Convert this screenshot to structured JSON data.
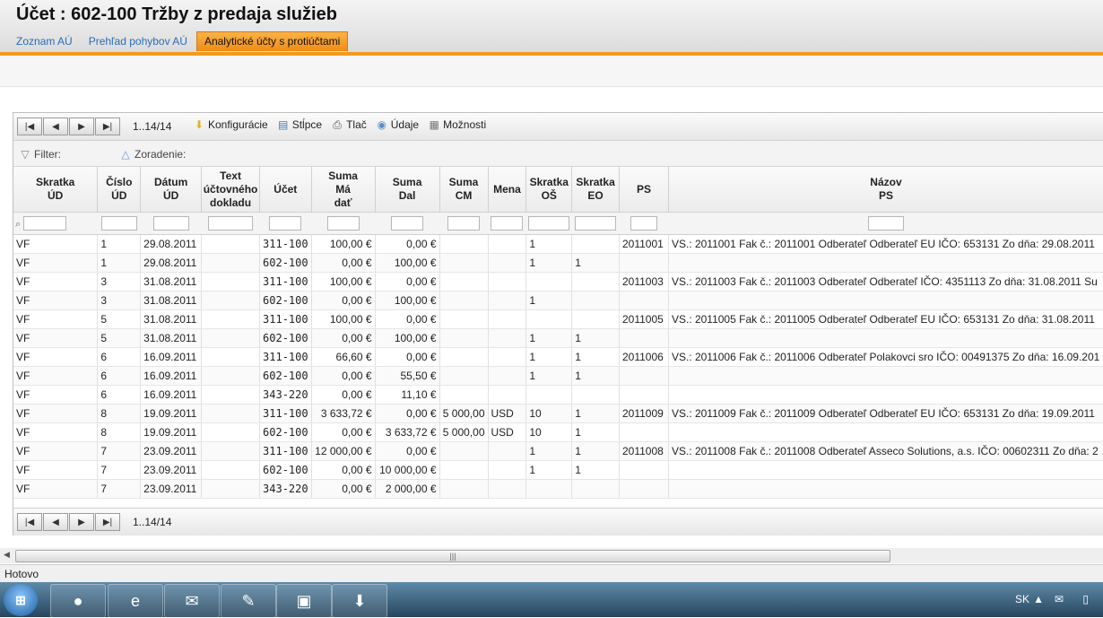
{
  "window": {
    "title": "Účet :  602-100 Tržby z predaja služieb"
  },
  "tabs": [
    {
      "label": "Zoznam AÚ",
      "active": false
    },
    {
      "label": "Prehľad pohybov AÚ",
      "active": false
    },
    {
      "label": "Analytické účty s protiúčtami",
      "active": true
    }
  ],
  "toolbar": {
    "pager_text": "1..14/14",
    "configs": "Konfigurácie",
    "columns": "Stĺpce",
    "print": "Tlač",
    "data": "Údaje",
    "options": "Možnosti"
  },
  "filterbar": {
    "filter_label": "Filter:",
    "sort_label": "Zoradenie:"
  },
  "columns": [
    "Skratka\nÚD",
    "Číslo\nÚD",
    "Dátum\nÚD",
    "Text\núčtovného\ndokladu",
    "Účet",
    "Suma\nMá\ndať",
    "Suma\nDal",
    "Suma\nCM",
    "Mena",
    "Skratka\nOŠ",
    "Skratka\nEO",
    "PS",
    "Názov\nPS"
  ],
  "rows": [
    [
      "VF",
      "1",
      "29.08.2011",
      "",
      "311-100",
      "100,00 €",
      "0,00 €",
      "",
      "",
      "1",
      "",
      "2011001",
      "VS.: 2011001 Fak č.: 2011001 Odberateľ Odberateľ EU IČO: 653131 Zo dňa: 29.08.2011"
    ],
    [
      "VF",
      "1",
      "29.08.2011",
      "",
      "602-100",
      "0,00 €",
      "100,00 €",
      "",
      "",
      "1",
      "1",
      "",
      ""
    ],
    [
      "VF",
      "3",
      "31.08.2011",
      "",
      "311-100",
      "100,00 €",
      "0,00 €",
      "",
      "",
      "",
      "",
      "2011003",
      "VS.: 2011003 Fak č.: 2011003 Odberateľ Odberateľ IČO: 4351113 Zo dňa: 31.08.2011 Su"
    ],
    [
      "VF",
      "3",
      "31.08.2011",
      "",
      "602-100",
      "0,00 €",
      "100,00 €",
      "",
      "",
      "1",
      "",
      "",
      ""
    ],
    [
      "VF",
      "5",
      "31.08.2011",
      "",
      "311-100",
      "100,00 €",
      "0,00 €",
      "",
      "",
      "",
      "",
      "2011005",
      "VS.: 2011005 Fak č.: 2011005 Odberateľ Odberateľ EU IČO: 653131 Zo dňa: 31.08.2011"
    ],
    [
      "VF",
      "5",
      "31.08.2011",
      "",
      "602-100",
      "0,00 €",
      "100,00 €",
      "",
      "",
      "1",
      "1",
      "",
      ""
    ],
    [
      "VF",
      "6",
      "16.09.2011",
      "",
      "311-100",
      "66,60 €",
      "0,00 €",
      "",
      "",
      "1",
      "1",
      "2011006",
      "VS.: 2011006 Fak č.: 2011006 Odberateľ Polakovci sro IČO: 00491375 Zo dňa: 16.09.201"
    ],
    [
      "VF",
      "6",
      "16.09.2011",
      "",
      "602-100",
      "0,00 €",
      "55,50 €",
      "",
      "",
      "1",
      "1",
      "",
      ""
    ],
    [
      "VF",
      "6",
      "16.09.2011",
      "",
      "343-220",
      "0,00 €",
      "11,10 €",
      "",
      "",
      "",
      "",
      "",
      ""
    ],
    [
      "VF",
      "8",
      "19.09.2011",
      "",
      "311-100",
      "3 633,72 €",
      "0,00 €",
      "5 000,00",
      "USD",
      "10",
      "1",
      "2011009",
      "VS.: 2011009 Fak č.: 2011009 Odberateľ Odberateľ EU IČO: 653131 Zo dňa: 19.09.2011"
    ],
    [
      "VF",
      "8",
      "19.09.2011",
      "",
      "602-100",
      "0,00 €",
      "3 633,72 €",
      "5 000,00",
      "USD",
      "10",
      "1",
      "",
      ""
    ],
    [
      "VF",
      "7",
      "23.09.2011",
      "",
      "311-100",
      "12 000,00 €",
      "0,00 €",
      "",
      "",
      "1",
      "1",
      "2011008",
      "VS.: 2011008 Fak č.: 2011008 Odberateľ Asseco Solutions, a.s. IČO: 00602311 Zo dňa: 2"
    ],
    [
      "VF",
      "7",
      "23.09.2011",
      "",
      "602-100",
      "0,00 €",
      "10 000,00 €",
      "",
      "",
      "1",
      "1",
      "",
      ""
    ],
    [
      "VF",
      "7",
      "23.09.2011",
      "",
      "343-220",
      "0,00 €",
      "2 000,00 €",
      "",
      "",
      "",
      "",
      "",
      ""
    ]
  ],
  "bottom_pager_text": "1..14/14",
  "status": "Hotovo",
  "taskbar": {
    "lang": "SK"
  },
  "colors": {
    "accent": "#f39a1e",
    "link": "#2a6db5"
  }
}
